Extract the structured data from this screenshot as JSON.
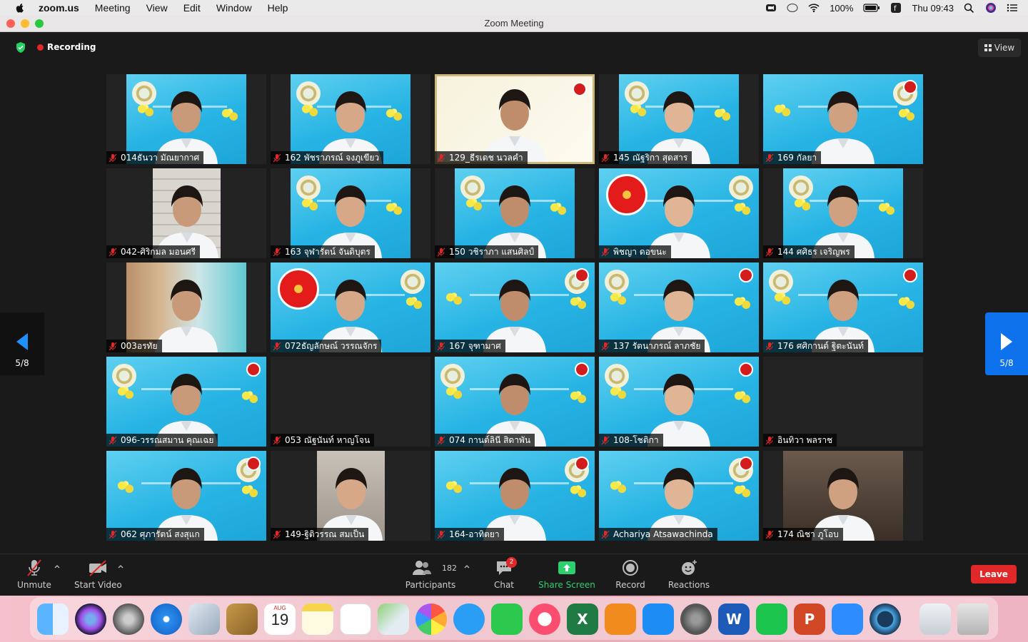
{
  "menubar": {
    "app": "zoom.us",
    "items": [
      "Meeting",
      "View",
      "Edit",
      "Window",
      "Help"
    ],
    "battery": "100%",
    "clock": "Thu 09:43"
  },
  "window": {
    "title": "Zoom Meeting"
  },
  "top": {
    "recording": "Recording",
    "view_button": "View"
  },
  "pager": {
    "left": "5/8",
    "right": "5/8"
  },
  "participants": [
    {
      "name": "014ธันวา มัณยากาศ"
    },
    {
      "name": "162 พัชราภรณ์ จงภูเขียว"
    },
    {
      "name": "129_ธีรเดช นวลคำ"
    },
    {
      "name": "145 ณัฐริกา สุดสาร"
    },
    {
      "name": "169 กัลยา"
    },
    {
      "name": "042-ศิริกมล มอนศรี"
    },
    {
      "name": "163 จุฬารัตน์ จันดิบุตร"
    },
    {
      "name": "150 วชิราภา แสนศิลป์"
    },
    {
      "name": "พิชญา ดอขนะ"
    },
    {
      "name": "144 ศศิธร เจริญพร"
    },
    {
      "name": "003อรทัย"
    },
    {
      "name": "072ธัญลักษณ์ วรรณจักร"
    },
    {
      "name": "167 จุฑามาศ"
    },
    {
      "name": "137 รัตนาภรณ์ ลาภชัย"
    },
    {
      "name": "176 ศศิกานต์ ฐิตะนันท์"
    },
    {
      "name": "096-วรรณสมาน คุณเฉย"
    },
    {
      "name": "053 ณัฐนันท์ หาญโจน"
    },
    {
      "name": "074 กานต์ลินี สิดาพัน"
    },
    {
      "name": "108-โชติกา"
    },
    {
      "name": "อินทิวา พลราช"
    },
    {
      "name": "062 ศุภารัตน์ สงสุแก"
    },
    {
      "name": "149-ฐิติวรรณ สมเป็น"
    },
    {
      "name": "164-อาทิตยา"
    },
    {
      "name": "Achariya Atsawachinda"
    },
    {
      "name": "174 ณิชา ภูโอบ"
    }
  ],
  "toolbar": {
    "unmute": "Unmute",
    "start_video": "Start Video",
    "participants_label": "Participants",
    "participants_count": "182",
    "chat": "Chat",
    "chat_badge": "2",
    "share": "Share Screen",
    "record": "Record",
    "reactions": "Reactions",
    "leave": "Leave"
  },
  "dock": {
    "calendar_month": "AUG",
    "calendar_day": "19"
  },
  "colors": {
    "accent_blue": "#0e72ed",
    "leave_red": "#e02828",
    "share_green": "#2dcf6f"
  }
}
